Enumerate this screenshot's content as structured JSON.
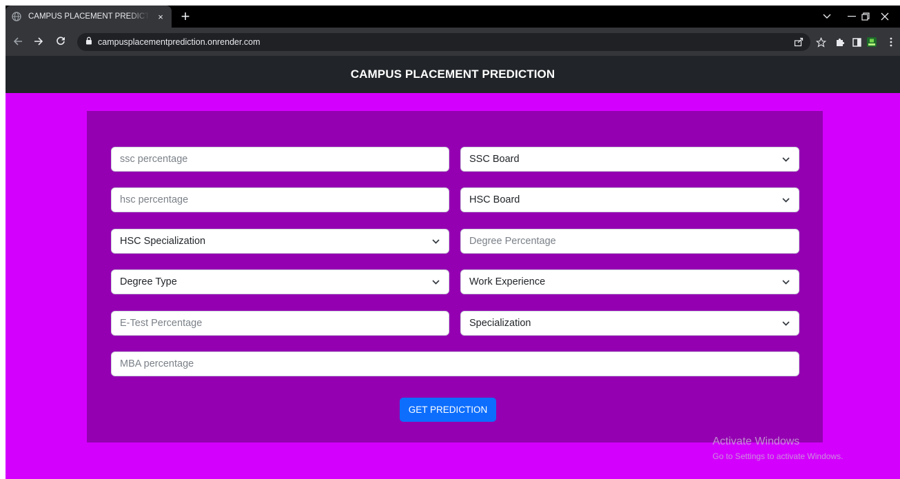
{
  "browser": {
    "tab_title": "CAMPUS PLACEMENT PREDICTION",
    "tab_close": "×",
    "new_tab": "+",
    "url": "campusplacementprediction.onrender.com"
  },
  "navbar": {
    "brand": "CAMPUS PLACEMENT PREDICTION"
  },
  "form": {
    "ssc_percentage": {
      "placeholder": "ssc percentage"
    },
    "ssc_board": {
      "selected": "SSC Board"
    },
    "hsc_percentage": {
      "placeholder": "hsc percentage"
    },
    "hsc_board": {
      "selected": "HSC Board"
    },
    "hsc_specialization": {
      "selected": "HSC Specialization"
    },
    "degree_percentage": {
      "placeholder": "Degree Percentage"
    },
    "degree_type": {
      "selected": "Degree Type"
    },
    "work_experience": {
      "selected": "Work Experience"
    },
    "etest_percentage": {
      "placeholder": "E-Test Percentage"
    },
    "specialization": {
      "selected": "Specialization"
    },
    "mba_percentage": {
      "placeholder": "MBA percentage"
    },
    "submit_label": "GET PREDICTION"
  },
  "watermark": {
    "title": "Activate Windows",
    "subtitle": "Go to Settings to activate Windows."
  },
  "colors": {
    "page_bg": "#d400fe",
    "card_bg": "#9400b1",
    "navbar_bg": "#212529",
    "button_bg": "#0d6efd"
  }
}
